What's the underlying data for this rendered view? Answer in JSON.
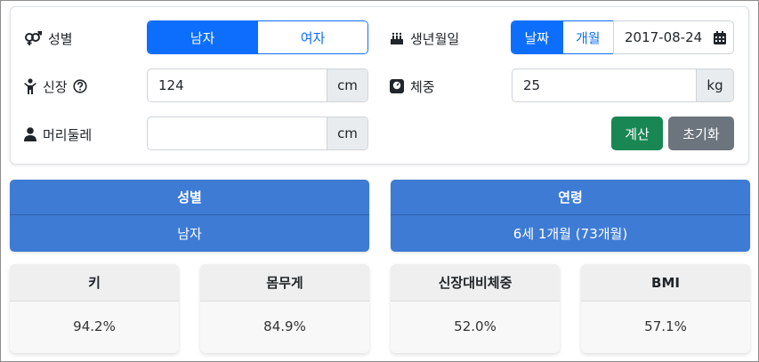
{
  "form": {
    "gender": {
      "label": "성별",
      "options": [
        "남자",
        "여자"
      ],
      "selected": "남자"
    },
    "birthdate": {
      "label": "생년월일",
      "modes": [
        "날짜",
        "개월"
      ],
      "selected_mode": "날짜",
      "value": "2017-08-24"
    },
    "height": {
      "label": "신장",
      "value": "124",
      "unit": "cm"
    },
    "weight": {
      "label": "체중",
      "value": "25",
      "unit": "kg"
    },
    "head": {
      "label": "머리둘레",
      "value": "",
      "unit": "cm"
    },
    "calc_label": "계산",
    "reset_label": "초기화"
  },
  "results": {
    "gender": {
      "header": "성별",
      "value": "남자"
    },
    "age": {
      "header": "연령",
      "value": "6세 1개월 (73개월)"
    }
  },
  "stats": [
    {
      "header": "키",
      "value": "94.2%"
    },
    {
      "header": "몸무게",
      "value": "84.9%"
    },
    {
      "header": "신장대비체중",
      "value": "52.0%"
    },
    {
      "header": "BMI",
      "value": "57.1%"
    }
  ],
  "colors": {
    "primary": "#0d6efd",
    "success": "#198754",
    "secondary": "#6c757d",
    "result_bg": "#3d7bd5"
  }
}
